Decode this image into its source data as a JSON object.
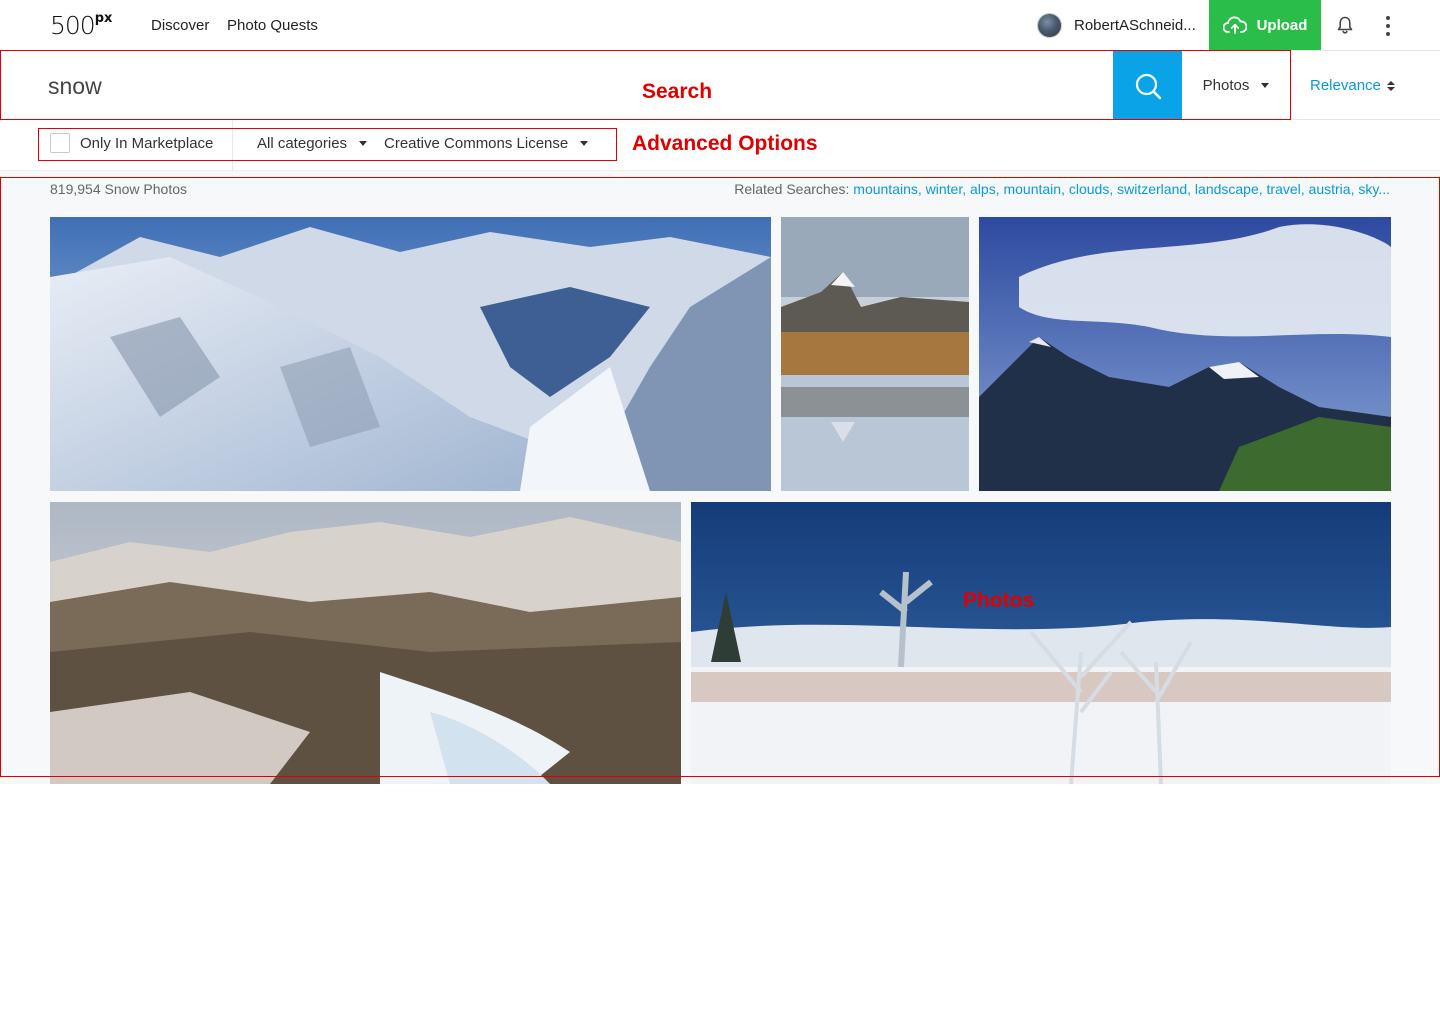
{
  "brand": {
    "logo_text": "500",
    "logo_sup": "px"
  },
  "nav": {
    "discover": "Discover",
    "photo_quests": "Photo Quests"
  },
  "user": {
    "name": "RobertASchneid..."
  },
  "upload": {
    "label": "Upload"
  },
  "search": {
    "value": "snow",
    "type_label": "Photos",
    "sort_label": "Relevance"
  },
  "advanced": {
    "marketplace_label": "Only In Marketplace",
    "category_label": "All categories",
    "license_label": "Creative Commons License"
  },
  "results": {
    "count_text": "819,954 Snow Photos",
    "related_label": "Related Searches:",
    "related": [
      "mountains",
      "winter",
      "alps",
      "mountain",
      "clouds",
      "switzerland",
      "landscape",
      "travel",
      "austria",
      "sky..."
    ]
  },
  "annotations": {
    "search": "Search",
    "advanced": "Advanced Options",
    "photos": "Photos"
  },
  "colors": {
    "upload_green": "#2bbd4a",
    "search_blue": "#0ba3e8",
    "link_blue": "#0b98dd",
    "annotation_red": "#e00000"
  }
}
